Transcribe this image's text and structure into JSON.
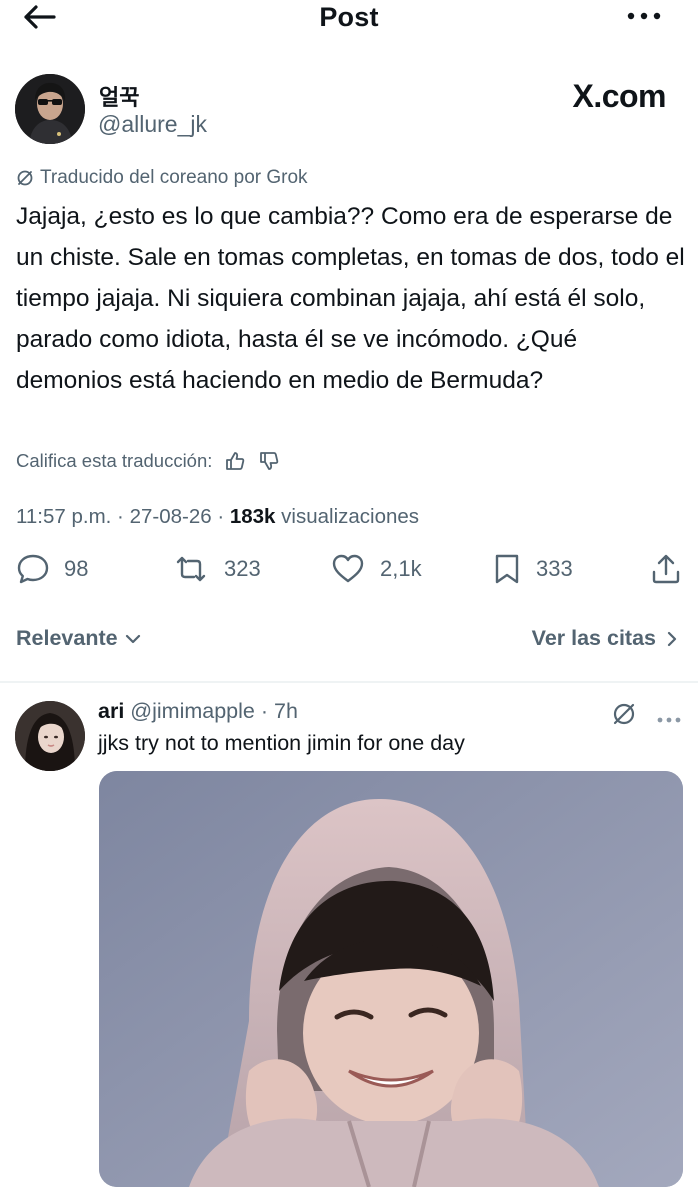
{
  "header": {
    "title": "Post"
  },
  "post": {
    "author_name": "얼꾹",
    "author_handle": "@allure_jk",
    "brand": "X.com",
    "translated_note": "Traducido del coreano por Grok",
    "text": "Jajaja, ¿esto es lo que cambia?? Como era de esperarse de un chiste. Sale en tomas completas, en tomas de dos, todo el tiempo jajaja. Ni siquiera combinan jajaja, ahí está él solo, parado como idiota, hasta él se ve incómodo. ¿Qué demonios está haciendo en medio de Bermuda?",
    "rate_translation": "Califica esta traducción:",
    "time": "11:57 p.m.",
    "date": "27-08-26",
    "views_count": "183k",
    "views_label": "visualizaciones",
    "replies": "98",
    "reposts": "323",
    "likes": "2,1k",
    "bookmarks": "333"
  },
  "filters": {
    "sort_label": "Relevante",
    "quotes_label": "Ver las citas"
  },
  "reply": {
    "name": "ari",
    "handle": "@jimimapple",
    "age": "7h",
    "text": "jjks try not to mention jimin for one day"
  },
  "icons": {
    "back": "arrow-left-icon",
    "more": "more-horizontal-icon",
    "translate": "grok-slash-icon",
    "like_translation": "thumbs-up-icon",
    "dislike_translation": "thumbs-down-icon",
    "reply": "reply-bubble-icon",
    "repost": "repost-icon",
    "like": "heart-icon",
    "bookmark": "bookmark-icon",
    "share": "share-icon",
    "chevron_down": "chevron-down-icon",
    "chevron_right": "chevron-right-icon"
  },
  "colors": {
    "text": "#0f1419",
    "secondary": "#536471",
    "divider": "#eff3f4"
  }
}
